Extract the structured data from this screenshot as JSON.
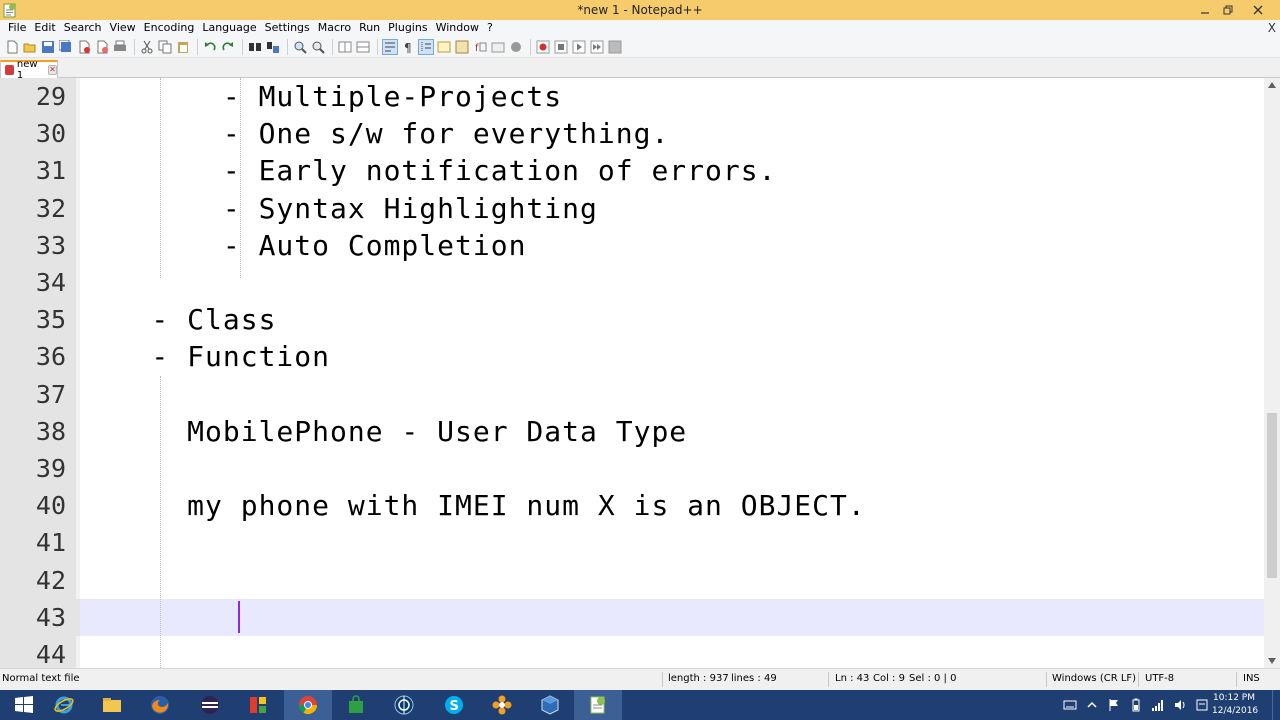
{
  "window": {
    "title": "*new 1 - Notepad++",
    "titlebar_color": "#f6cb6b"
  },
  "menu": {
    "items": [
      "File",
      "Edit",
      "Search",
      "View",
      "Encoding",
      "Language",
      "Settings",
      "Macro",
      "Run",
      "Plugins",
      "Window",
      "?"
    ],
    "close_glyph": "X"
  },
  "toolbar": {
    "icons": [
      "new-file-icon",
      "open-file-icon",
      "save-icon",
      "save-all-icon",
      "close-file-icon",
      "close-all-icon",
      "print-icon",
      "cut-icon",
      "copy-icon",
      "paste-icon",
      "undo-icon",
      "redo-icon",
      "find-icon",
      "replace-icon",
      "zoom-in-icon",
      "zoom-out-icon",
      "sync-vertical-icon",
      "sync-horizontal-icon",
      "word-wrap-icon",
      "show-all-chars-icon",
      "indent-guide-icon",
      "user-lang-icon",
      "doc-map-icon",
      "function-list-icon",
      "folder-as-workspace-icon",
      "monitoring-icon",
      "record-macro-icon",
      "stop-macro-icon",
      "play-macro-icon",
      "run-macro-multiple-icon",
      "save-macro-icon"
    ]
  },
  "tabs": [
    {
      "label": "new 1",
      "active": true
    }
  ],
  "editor": {
    "current_line": 43,
    "lines": [
      {
        "num": "29",
        "text": "        - Multiple-Projects"
      },
      {
        "num": "30",
        "text": "        - One s/w for everything."
      },
      {
        "num": "31",
        "text": "        - Early notification of errors."
      },
      {
        "num": "32",
        "text": "        - Syntax Highlighting"
      },
      {
        "num": "33",
        "text": "        - Auto Completion"
      },
      {
        "num": "34",
        "text": ""
      },
      {
        "num": "35",
        "text": "    - Class"
      },
      {
        "num": "36",
        "text": "    - Function"
      },
      {
        "num": "37",
        "text": ""
      },
      {
        "num": "38",
        "text": "      MobilePhone - User Data Type"
      },
      {
        "num": "39",
        "text": ""
      },
      {
        "num": "40",
        "text": "      my phone with IMEI num X is an OBJECT."
      },
      {
        "num": "41",
        "text": ""
      },
      {
        "num": "42",
        "text": ""
      },
      {
        "num": "43",
        "text": ""
      },
      {
        "num": "44",
        "text": ""
      }
    ],
    "current_line_color": "#e8e8ff",
    "caret_color": "#8a2be2"
  },
  "statusbar": {
    "file_type": "Normal text file",
    "length": "length : 937",
    "lines": "lines : 49",
    "ln": "Ln : 43",
    "col": "Col : 9",
    "sel": "Sel : 0 | 0",
    "eol": "Windows (CR LF)",
    "encoding": "UTF-8",
    "mode": "INS"
  },
  "taskbar": {
    "apps": [
      "windows-start-icon",
      "internet-explorer-icon",
      "file-explorer-icon",
      "firefox-icon",
      "eclipse-icon",
      "media-app-icon",
      "chrome-icon",
      "shopping-bag-icon",
      "network-icon",
      "skype-icon",
      "settings-flower-icon",
      "virtualbox-icon",
      "notepad-plus-plus-icon"
    ],
    "clock_time": "10:12 PM",
    "clock_date": "12/4/2016",
    "color": "#1f3f73"
  }
}
